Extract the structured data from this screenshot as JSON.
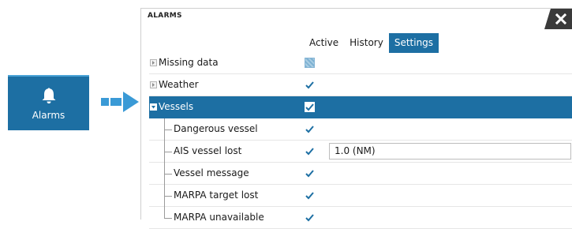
{
  "launcher": {
    "label": "Alarms",
    "icon": "bell-icon"
  },
  "dialog": {
    "title": "ALARMS",
    "tabs": [
      {
        "label": "Active",
        "active": false
      },
      {
        "label": "History",
        "active": false
      },
      {
        "label": "Settings",
        "active": true
      }
    ],
    "rows": [
      {
        "label": "Missing data",
        "type": "group",
        "expanded": false,
        "checked": false,
        "state": "indeterminate"
      },
      {
        "label": "Weather",
        "type": "group",
        "expanded": false,
        "checked": true
      },
      {
        "label": "Vessels",
        "type": "group",
        "expanded": true,
        "checked": true,
        "selected": true
      },
      {
        "label": "Dangerous vessel",
        "type": "child",
        "checked": true
      },
      {
        "label": "AIS vessel lost",
        "type": "child",
        "checked": true,
        "value": "1.0 (NM)"
      },
      {
        "label": "Vessel message",
        "type": "child",
        "checked": true
      },
      {
        "label": "MARPA target lost",
        "type": "child",
        "checked": true
      },
      {
        "label": "MARPA unavailable",
        "type": "child",
        "checked": true
      }
    ]
  },
  "colors": {
    "accent": "#1d6fa3",
    "check": "#1d6fa3",
    "close_bg": "#3a3a3a"
  }
}
